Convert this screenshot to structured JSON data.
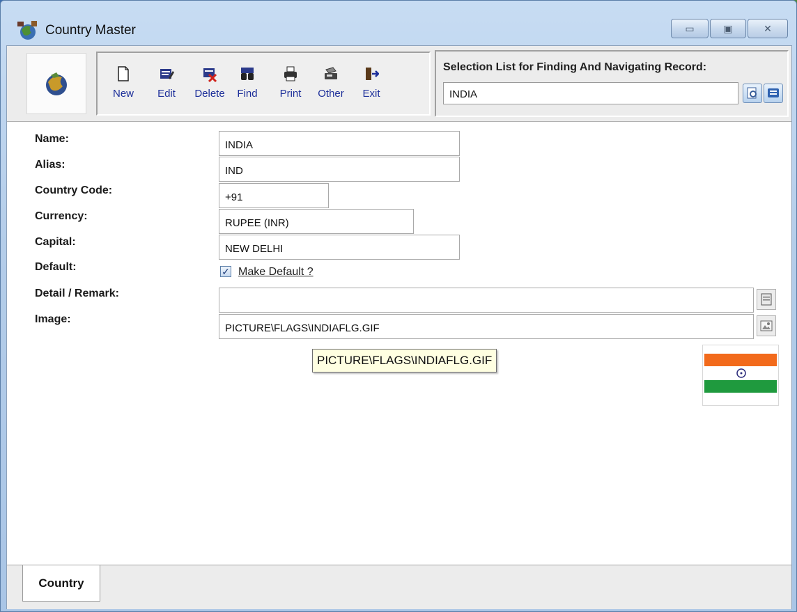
{
  "window": {
    "title": "Country Master",
    "controls": {
      "minimize": "▭",
      "maximize": "▣",
      "close": "✕"
    }
  },
  "toolbar": {
    "buttons": [
      {
        "label": "New",
        "icon": "new-document-icon"
      },
      {
        "label": "Edit",
        "icon": "edit-icon"
      },
      {
        "label": "Delete",
        "icon": "delete-icon"
      },
      {
        "label": "Find",
        "icon": "find-binoculars-icon"
      },
      {
        "label": "Print",
        "icon": "printer-icon"
      },
      {
        "label": "Other",
        "icon": "other-icon"
      },
      {
        "label": "Exit",
        "icon": "exit-door-icon"
      }
    ]
  },
  "selection": {
    "label": "Selection List for Finding And Navigating Record:",
    "value": "INDIA"
  },
  "form": {
    "labels": {
      "name": "Name:",
      "alias": "Alias:",
      "country_code": "Country Code:",
      "currency": "Currency:",
      "capital": "Capital:",
      "default": "Default:",
      "detail": "Detail / Remark:",
      "image": "Image:"
    },
    "values": {
      "name": "INDIA",
      "alias": "IND",
      "country_code": "+91",
      "currency": "RUPEE (INR)",
      "capital": "NEW DELHI",
      "detail": "",
      "image": "PICTURE\\FLAGS\\INDIAFLG.GIF"
    },
    "make_default_label": "Make Default ?",
    "make_default_checked": true,
    "tooltip": "PICTURE\\FLAGS\\INDIAFLG.GIF"
  },
  "tabs": [
    {
      "label": "Country",
      "active": true
    }
  ],
  "colors": {
    "toolbar_label": "#1d2f9a",
    "flag_saffron": "#f26a1b",
    "flag_green": "#1f9a3e",
    "flag_chakra": "#2a2a7a"
  }
}
